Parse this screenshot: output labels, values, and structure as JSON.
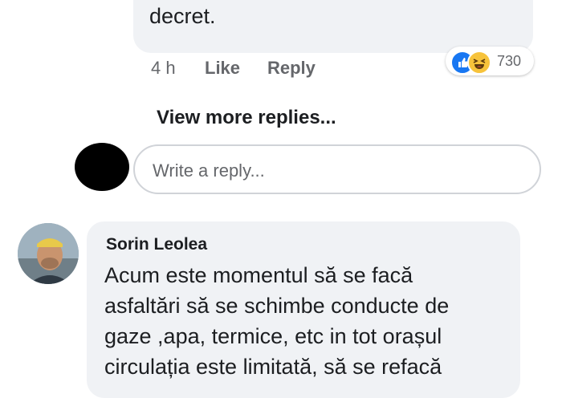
{
  "top_comment": {
    "text": "apar chiar dacă este interzis prin\ndecret.",
    "time": "4 h",
    "like_label": "Like",
    "reply_label": "Reply",
    "reactions": {
      "icons": [
        "like-icon",
        "haha-icon"
      ],
      "count": "730",
      "colors": {
        "like": "#1877f2",
        "haha": "#f7c33b"
      }
    }
  },
  "view_more_replies": "View more replies...",
  "reply_box": {
    "placeholder": "Write a reply..."
  },
  "comment_sorin": {
    "author": "Sorin Leolea",
    "text": "Acum este momentul să se facă\nasfaltări să se schimbe conducte de\ngaze ,apa, termice, etc in tot orașul\ncirculația este limitată, să se refacă"
  },
  "colors": {
    "bubble_bg": "#f0f2f5",
    "text_primary": "#1c1e21",
    "text_secondary": "#65676b"
  }
}
